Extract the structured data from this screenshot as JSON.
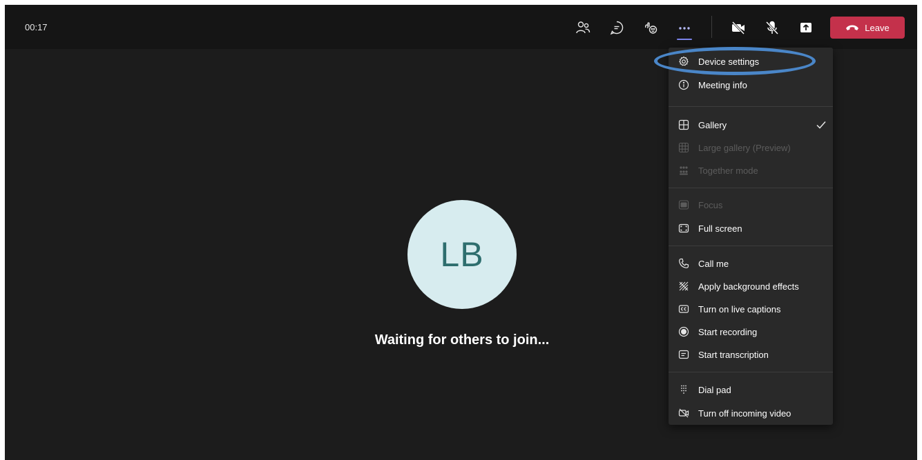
{
  "meeting": {
    "timer": "00:17",
    "avatar_initials": "LB",
    "status_text": "Waiting for others to join..."
  },
  "toolbar": {
    "leave_label": "Leave",
    "icons": [
      "people-icon",
      "chat-icon",
      "reactions-icon",
      "more-options-icon",
      "camera-off-icon",
      "mic-off-icon",
      "share-screen-icon",
      "hang-up-icon"
    ],
    "colors": {
      "leave": "#c4314b",
      "accent": "#7b83eb",
      "highlight_ring": "#4a86c8"
    }
  },
  "menu": {
    "items": {
      "device_settings": "Device settings",
      "meeting_info": "Meeting info",
      "gallery": "Gallery",
      "large_gallery": "Large gallery (Preview)",
      "together_mode": "Together mode",
      "focus": "Focus",
      "full_screen": "Full screen",
      "call_me": "Call me",
      "background_effects": "Apply background effects",
      "live_captions": "Turn on live captions",
      "start_recording": "Start recording",
      "start_transcription": "Start transcription",
      "dial_pad": "Dial pad",
      "incoming_video": "Turn off incoming video"
    },
    "selected": "Gallery",
    "disabled": [
      "Large gallery (Preview)",
      "Together mode",
      "Focus"
    ]
  }
}
